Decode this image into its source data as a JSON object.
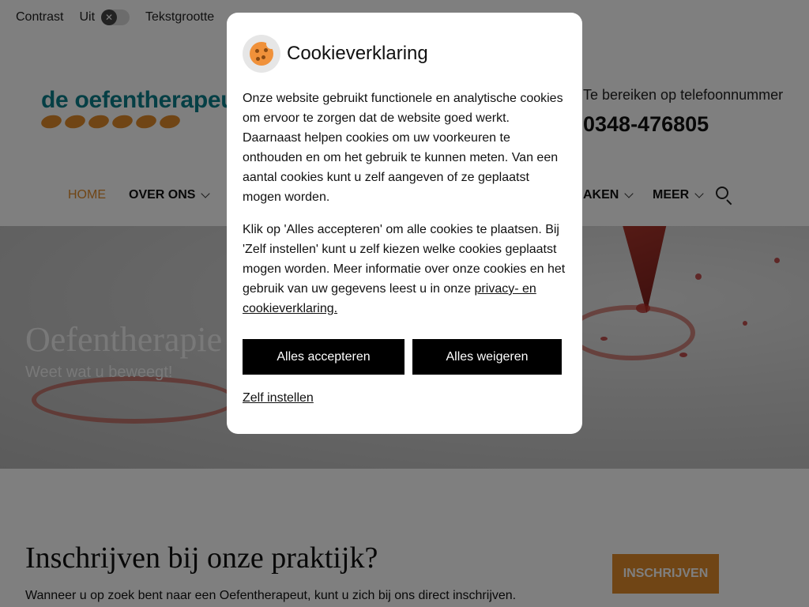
{
  "accessibility_bar": {
    "contrast_label": "Contrast",
    "contrast_state": "Uit",
    "toggle_glyph": "✕",
    "text_size_label": "Tekstgrootte"
  },
  "header": {
    "logo_text": "de oefentherapeut",
    "phone_label": "Te bereiken op telefoonnummer",
    "phone_number": "0348-476805"
  },
  "nav": {
    "items": [
      {
        "label": "HOME",
        "active": true
      },
      {
        "label": "OVER ONS",
        "has_dropdown": true
      },
      {
        "label": "AKEN",
        "has_dropdown": true
      },
      {
        "label": "MEER",
        "has_dropdown": true
      }
    ]
  },
  "hero": {
    "title": "Oefentherapie",
    "subtitle": "Weet wat u beweegt!"
  },
  "content": {
    "title": "Inschrijven bij onze praktijk?",
    "text": "Wanneer u op zoek bent naar een Oefentherapeut, kunt u zich bij ons direct inschrijven.",
    "cta_label": "INSCHRIJVEN"
  },
  "cookie_modal": {
    "title": "Cookieverklaring",
    "paragraph1": "Onze website gebruikt functionele en analytische cookies om ervoor te zorgen dat de website goed werkt. Daarnaast helpen cookies om uw voorkeuren te onthouden en om het gebruik te kunnen meten. Van een aantal cookies kunt u zelf aangeven of ze geplaatst mogen worden.",
    "paragraph2_text": "Klik op 'Alles accepteren' om alle cookies te plaatsen. Bij 'Zelf instellen' kunt u zelf kiezen welke cookies geplaatst mogen worden. Meer informatie over onze cookies en het gebruik van uw gegevens leest u in onze ",
    "paragraph2_link": "privacy- en cookieverklaring.",
    "accept_label": "Alles accepteren",
    "reject_label": "Alles weigeren",
    "customize_label": "Zelf instellen"
  },
  "colors": {
    "accent": "#e08a2a",
    "brand_teal": "#0a7f8a",
    "button_bg": "#000000",
    "overlay": "rgba(0,0,0,0.5)"
  }
}
